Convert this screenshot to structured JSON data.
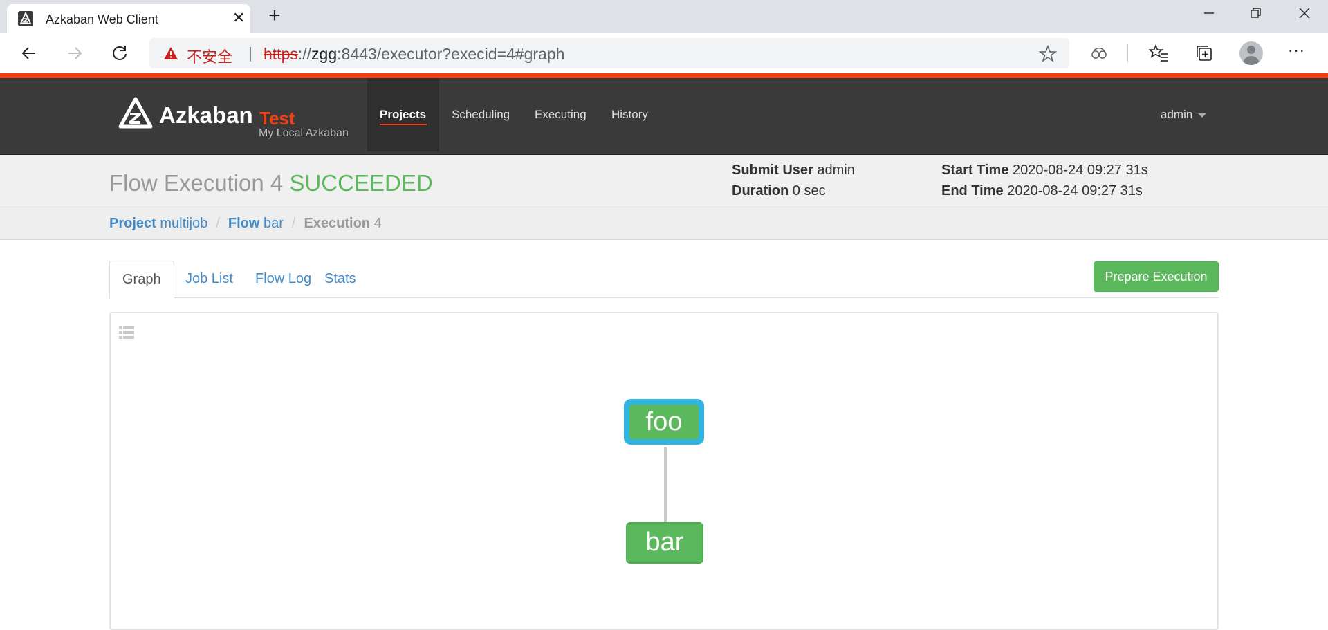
{
  "browser": {
    "tab_title": "Azkaban Web Client",
    "insecure_label": "不安全",
    "url_scheme": "https",
    "url_sep": "://",
    "url_host": "zgg",
    "url_rest": ":8443/executor?execid=4#graph"
  },
  "app": {
    "brand_name": "Azkaban",
    "brand_env": "Test",
    "brand_subtitle": "My Local Azkaban",
    "nav": [
      {
        "label": "Projects",
        "active": true
      },
      {
        "label": "Scheduling"
      },
      {
        "label": "Executing"
      },
      {
        "label": "History"
      }
    ],
    "user": "admin",
    "accent_color": "#f23e13"
  },
  "execution": {
    "title_prefix": "Flow Execution 4",
    "status": "SUCCEEDED",
    "status_color": "#5cb85c",
    "submit_user_label": "Submit User",
    "submit_user": "admin",
    "duration_label": "Duration",
    "duration": "0 sec",
    "start_time_label": "Start Time",
    "start_time": "2020-08-24 09:27 31s",
    "end_time_label": "End Time",
    "end_time": "2020-08-24 09:27 31s"
  },
  "breadcrumb": {
    "project_label": "Project",
    "project": "multijob",
    "flow_label": "Flow",
    "flow": "bar",
    "execution_label": "Execution",
    "execution": "4"
  },
  "tabs": [
    {
      "label": "Graph",
      "active": true
    },
    {
      "label": "Job List"
    },
    {
      "label": "Flow Log"
    },
    {
      "label": "Stats"
    }
  ],
  "prepare_button": "Prepare Execution",
  "graph": {
    "nodes": [
      {
        "id": "foo",
        "status": "succeeded",
        "selected": true
      },
      {
        "id": "bar",
        "status": "succeeded"
      }
    ],
    "edges": [
      [
        "foo",
        "bar"
      ]
    ],
    "selected_color": "#31b4e0",
    "success_color": "#5cb85c"
  }
}
